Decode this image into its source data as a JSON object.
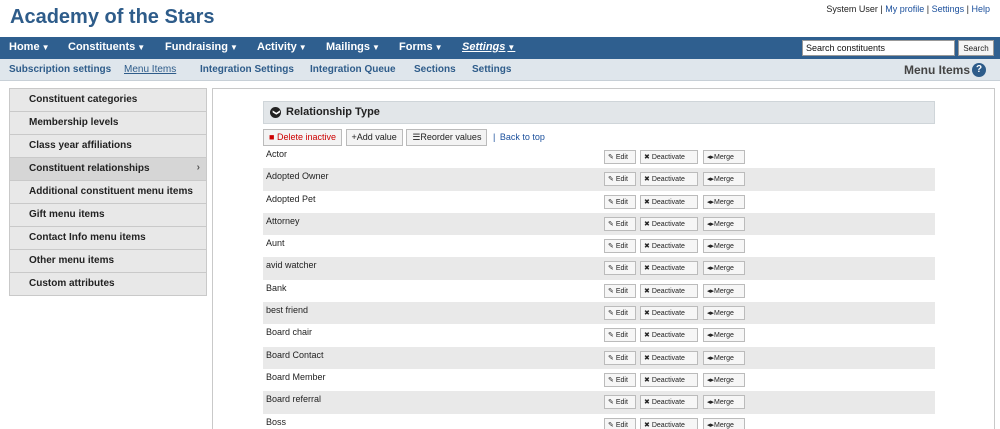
{
  "app": {
    "title": "Academy of the Stars"
  },
  "user_links": {
    "user": "System User",
    "sep": " | ",
    "profile": "My profile",
    "settings": "Settings",
    "help": "Help"
  },
  "nav": [
    {
      "label": "Home",
      "caret": "▼"
    },
    {
      "label": "Constituents",
      "caret": "▼"
    },
    {
      "label": "Fundraising",
      "caret": "▼"
    },
    {
      "label": "Activity",
      "caret": "▼"
    },
    {
      "label": "Mailings",
      "caret": "▼"
    },
    {
      "label": "Forms",
      "caret": "▼"
    },
    {
      "label": "Settings",
      "caret": "▼",
      "active": true
    }
  ],
  "search": {
    "value": "Search constituents",
    "button": "Search"
  },
  "subnav": [
    {
      "label": "Subscription settings"
    },
    {
      "label": "Menu Items",
      "active": true
    },
    {
      "label": "Integration Settings"
    },
    {
      "label": "Integration Queue"
    },
    {
      "label": "Sections"
    },
    {
      "label": "Settings"
    }
  ],
  "page_name": "Menu Items",
  "help_icon": "?",
  "sidebar": [
    {
      "label": "Constituent categories"
    },
    {
      "label": "Membership levels"
    },
    {
      "label": "Class year affiliations"
    },
    {
      "label": "Constituent relationships",
      "active": true,
      "chevron": "›"
    },
    {
      "label": "Additional constituent menu items"
    },
    {
      "label": "Gift menu items"
    },
    {
      "label": "Contact Info menu items"
    },
    {
      "label": "Other menu items"
    },
    {
      "label": "Custom attributes"
    }
  ],
  "panel": {
    "title": "Relationship Type",
    "toggle_icon": "❯"
  },
  "toolbar": {
    "delete_label": "Delete inactive",
    "add_label": "Add value",
    "reorder_label": "Reorder values",
    "back_label": "Back to top",
    "sep": "|"
  },
  "row_buttons": {
    "edit": "Edit",
    "deactivate": "Deactivate",
    "merge": "Merge"
  },
  "rows": [
    {
      "name": "Actor"
    },
    {
      "name": "Adopted Owner"
    },
    {
      "name": "Adopted Pet"
    },
    {
      "name": "Attorney"
    },
    {
      "name": "Aunt"
    },
    {
      "name": "avid watcher"
    },
    {
      "name": "Bank"
    },
    {
      "name": "best friend"
    },
    {
      "name": "Board chair"
    },
    {
      "name": "Board Contact"
    },
    {
      "name": "Board Member"
    },
    {
      "name": "Board referral"
    },
    {
      "name": "Boss"
    }
  ],
  "icons": {
    "pencil": "pencil-icon",
    "x": "x-icon",
    "merge": "merge-icon",
    "trash": "trash-icon",
    "plus": "plus-icon",
    "list": "list-icon"
  },
  "colors": {
    "nav_bg": "#2f5f8f",
    "title": "#2e5c8a",
    "danger": "#cc0000",
    "link": "#1a4f9c"
  }
}
